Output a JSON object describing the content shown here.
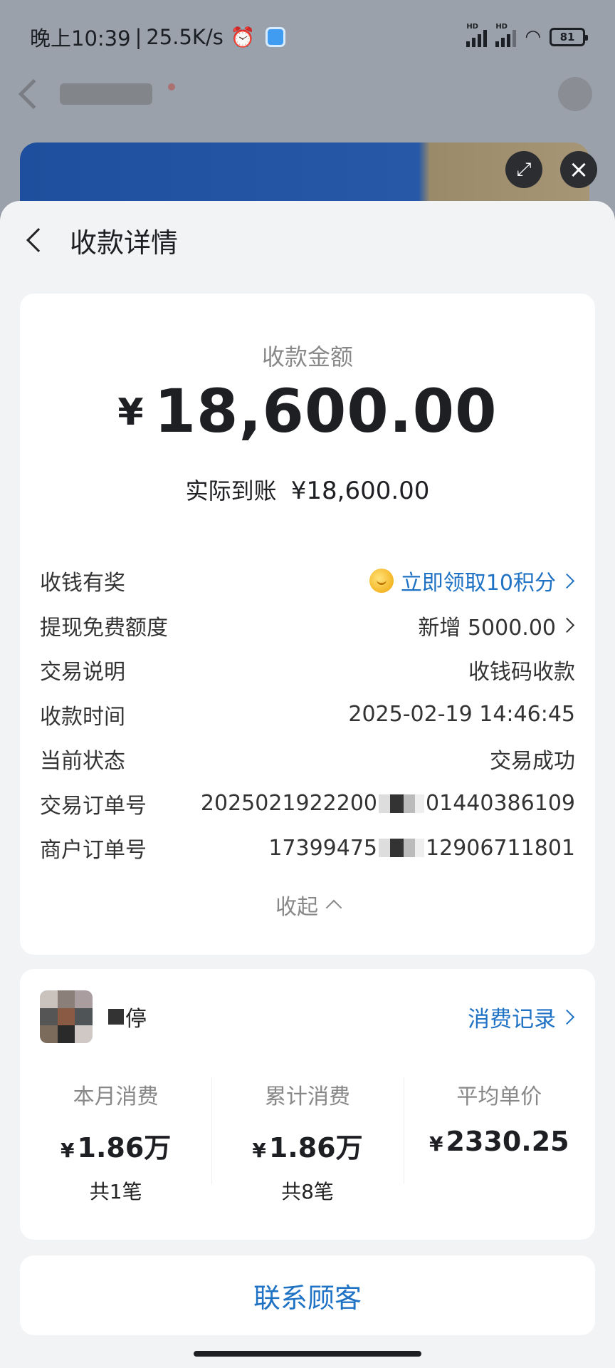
{
  "status_bar": {
    "time": "晚上10:39",
    "net_speed": "25.5K/s",
    "hd_label": "HD",
    "battery": "81"
  },
  "sheet": {
    "title": "收款详情"
  },
  "amount": {
    "label": "收款金额",
    "currency": "¥",
    "value": "18,600.00",
    "actual_label": "实际到账",
    "actual_value": "¥18,600.00"
  },
  "details": {
    "reward_label": "收钱有奖",
    "reward_value": "立即领取10积分",
    "quota_label": "提现免费额度",
    "quota_value": "新增 5000.00",
    "desc_label": "交易说明",
    "desc_value": "收钱码收款",
    "time_label": "收款时间",
    "time_value": "2025-02-19 14:46:45",
    "status_label": "当前状态",
    "status_value": "交易成功",
    "order_label": "交易订单号",
    "order_prefix": "2025021922200",
    "order_suffix": "01440386109",
    "merchant_label": "商户订单号",
    "merchant_prefix": "17399475",
    "merchant_suffix": "12906711801",
    "collapse_label": "收起"
  },
  "customer": {
    "name_suffix": "停",
    "records_link": "消费记录",
    "stats": [
      {
        "label": "本月消费",
        "value": "1.86万",
        "currency": "¥",
        "sub": "共1笔"
      },
      {
        "label": "累计消费",
        "value": "1.86万",
        "currency": "¥",
        "sub": "共8笔"
      },
      {
        "label": "平均单价",
        "value": "2330.25",
        "currency": "¥",
        "sub": ""
      }
    ]
  },
  "contact": {
    "label": "联系顾客"
  },
  "colors": {
    "link": "#1f72c4",
    "sheet_bg": "#f2f3f5",
    "card_bg": "#ffffff"
  }
}
